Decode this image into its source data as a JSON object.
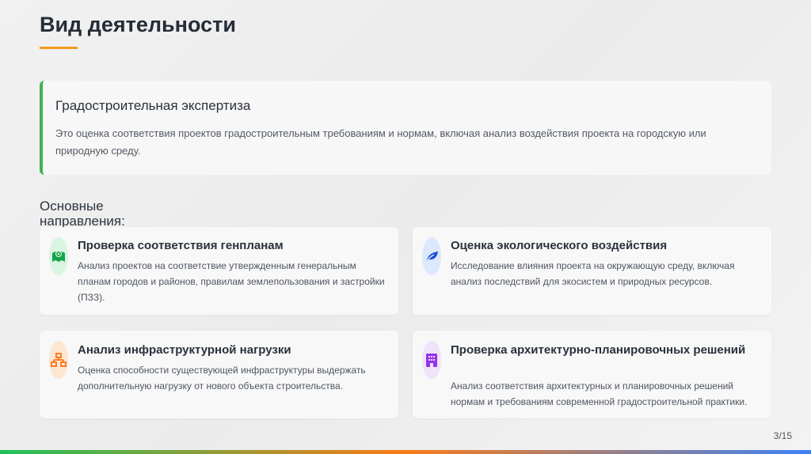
{
  "title": "Вид деятельности",
  "hero": {
    "title": "Градостроительная экспертиза",
    "text": "Это оценка соответствия проектов градостроительным требованиям и нормам, включая анализ воздействия проекта на городскую или природную среду."
  },
  "section_title": "Основные направления:",
  "cards": [
    {
      "icon": "map-pin-icon",
      "color": "#16a34a",
      "title": "Проверка соответствия генпланам",
      "text": "Анализ проектов на соответствие утвержденным генеральным планам городов и районов, правилам землепользования и застройки (ПЗЗ)."
    },
    {
      "icon": "leaf-icon",
      "color": "#1d4ed8",
      "title": "Оценка экологического воздействия",
      "text": "Исследование влияния проекта на окружающую среду, включая анализ последствий для экосистем и природных ресурсов."
    },
    {
      "icon": "network-icon",
      "color": "#f97316",
      "title": "Анализ инфраструктурной нагрузки",
      "text": "Оценка способности существующей инфраструктуры выдержать дополнительную нагрузку от нового объекта строительства."
    },
    {
      "icon": "building-icon",
      "color": "#9333ea",
      "title": "Проверка архитектурно-планировочных решений",
      "text": "Анализ соответствия архитектурных и планировочных решений нормам и требованиям современной градостроительной практики."
    }
  ],
  "page_number": "3/15"
}
